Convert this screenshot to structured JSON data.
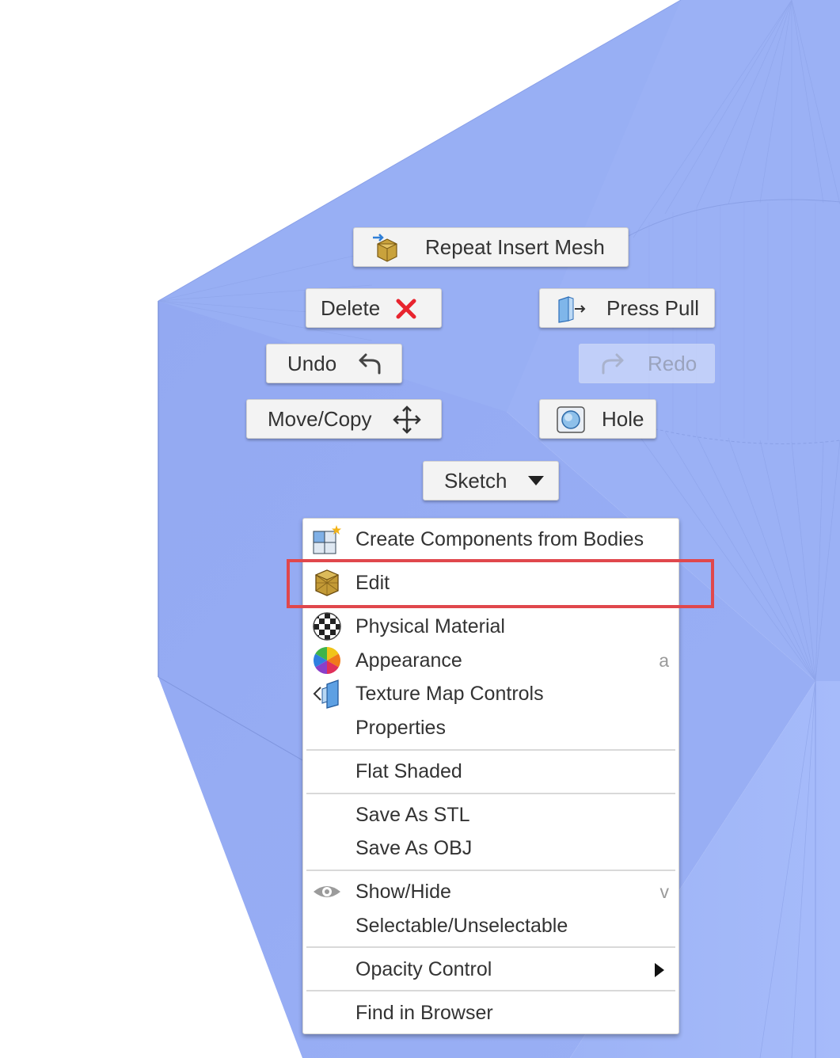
{
  "marking_menu": {
    "repeat_label": "Repeat Insert Mesh",
    "delete_label": "Delete",
    "press_pull_label": "Press Pull",
    "undo_label": "Undo",
    "redo_label": "Redo",
    "move_copy_label": "Move/Copy",
    "hole_label": "Hole",
    "sketch_label": "Sketch"
  },
  "context_menu": {
    "items": [
      {
        "label": "Create Components from Bodies",
        "icon": "create-components-icon"
      },
      {
        "label": "Edit",
        "icon": "mesh-edit-icon"
      },
      {
        "label": "Physical Material",
        "icon": "physical-material-icon"
      },
      {
        "label": "Appearance",
        "icon": "appearance-icon",
        "shortcut": "a"
      },
      {
        "label": "Texture Map Controls",
        "icon": "texture-map-icon"
      },
      {
        "label": "Properties"
      },
      {
        "label": "Flat Shaded"
      },
      {
        "label": "Save As STL"
      },
      {
        "label": "Save As OBJ"
      },
      {
        "label": "Show/Hide",
        "icon": "eye-icon",
        "shortcut": "v"
      },
      {
        "label": "Selectable/Unselectable"
      },
      {
        "label": "Opacity Control",
        "icon": "submenu-arrow-icon"
      },
      {
        "label": "Find in Browser"
      }
    ]
  },
  "colors": {
    "model_face": "#98aff4",
    "highlight": "#e0474c",
    "delete_x": "#e8242e"
  }
}
